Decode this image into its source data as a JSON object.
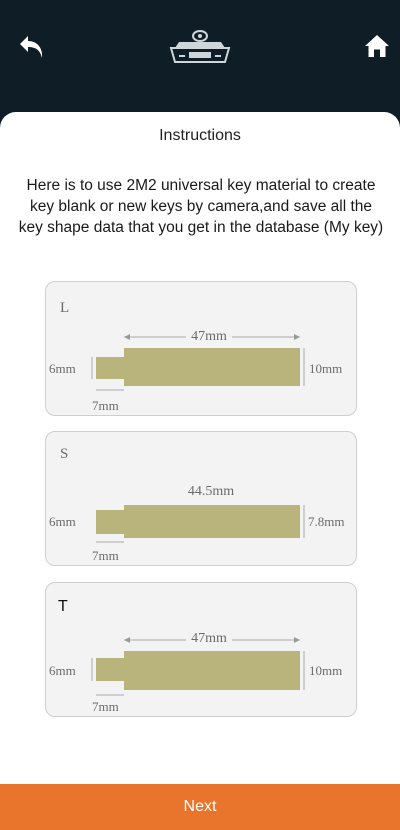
{
  "header": {
    "back_icon": "back-arrow-icon",
    "home_icon": "home-icon",
    "logo_icon": "key-machine-logo"
  },
  "page": {
    "title": "Instructions",
    "description": "Here is to use 2M2 universal key material to create key blank or new keys by camera,and save all the key shape data that you get in the database (My key)"
  },
  "cards": [
    {
      "type": "L",
      "length": "47mm",
      "height_left": "6mm",
      "height_right": "10mm",
      "step": "7mm"
    },
    {
      "type": "S",
      "length": "44.5mm",
      "height_left": "6mm",
      "height_right": "7.8mm",
      "step": "7mm"
    },
    {
      "type": "T",
      "length": "47mm",
      "height_left": "6mm",
      "height_right": "10mm",
      "step": "7mm"
    }
  ],
  "footer": {
    "next_label": "Next"
  },
  "colors": {
    "accent": "#e8752b",
    "key_fill": "#b8b47c",
    "header_bg": "#0f1d26"
  }
}
